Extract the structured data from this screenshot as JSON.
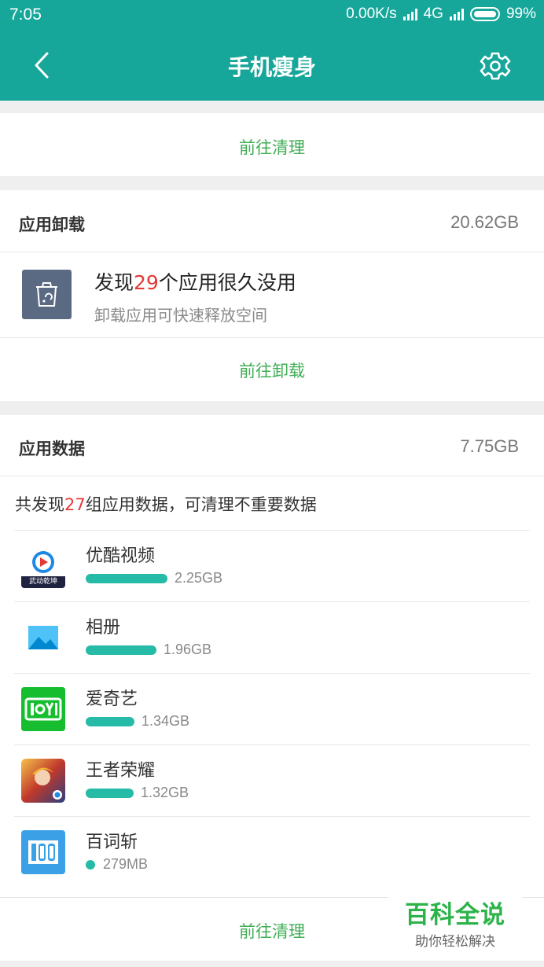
{
  "status_bar": {
    "time": "7:05",
    "net_speed": "0.00K/s",
    "network": "4G",
    "battery": "99%"
  },
  "header": {
    "title": "手机瘦身",
    "back_icon": "chevron-left-icon",
    "settings_icon": "gear-icon"
  },
  "top_section": {
    "action": "前往清理"
  },
  "uninstall_section": {
    "title": "应用卸载",
    "size": "20.62GB",
    "found_prefix": "发现",
    "found_count": "29",
    "found_suffix": "个应用很久没用",
    "subtitle": "卸载应用可快速释放空间",
    "action": "前往卸载"
  },
  "data_section": {
    "title": "应用数据",
    "size": "7.75GB",
    "summary_prefix": "共发现",
    "summary_count": "27",
    "summary_suffix": "组应用数据，可清理不重要数据",
    "apps": [
      {
        "name": "优酷视频",
        "size": "2.25GB",
        "fraction": 1.0
      },
      {
        "name": "相册",
        "size": "1.96GB",
        "fraction": 0.87
      },
      {
        "name": "爱奇艺",
        "size": "1.34GB",
        "fraction": 0.6
      },
      {
        "name": "王者荣耀",
        "size": "1.32GB",
        "fraction": 0.59
      },
      {
        "name": "百词斩",
        "size": "279MB",
        "fraction": 0.12
      }
    ],
    "youku_banner": "武动乾坤",
    "action": "前往清理"
  },
  "watermark": {
    "title": "百科全说",
    "subtitle": "助你轻松解决"
  },
  "colors": {
    "primary": "#16a79a",
    "action_green": "#3fae55",
    "bar": "#26bba6",
    "highlight_red": "#e53935"
  }
}
